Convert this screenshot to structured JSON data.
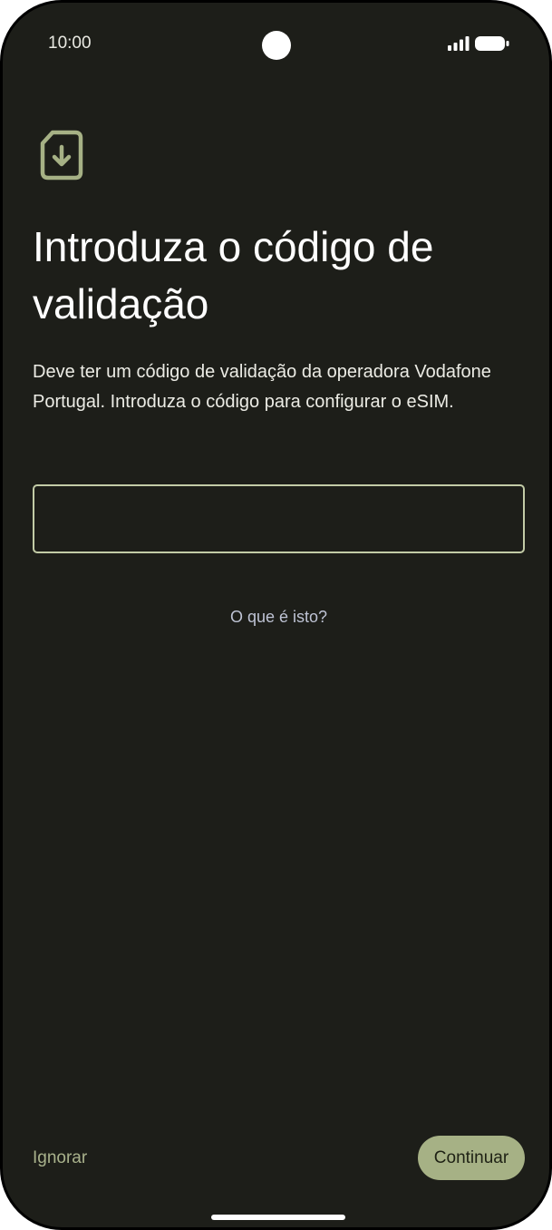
{
  "status_bar": {
    "time": "10:00",
    "icons": [
      "signal-icon",
      "battery-icon"
    ]
  },
  "header": {
    "icon": "sim-download-icon",
    "title": "Introduza o código de validação"
  },
  "main": {
    "description": "Deve ter um código de validação da operadora Vodafone Portugal. Introduza o código para configurar o eSIM.",
    "code_field": {
      "value": "",
      "placeholder": ""
    },
    "help_link": "O que é isto?"
  },
  "footer": {
    "skip_label": "Ignorar",
    "continue_label": "Continuar"
  },
  "colors": {
    "background": "#1d1e19",
    "accent": "#a6b185",
    "field_border": "#c2cba6",
    "link": "#bec3d4"
  }
}
